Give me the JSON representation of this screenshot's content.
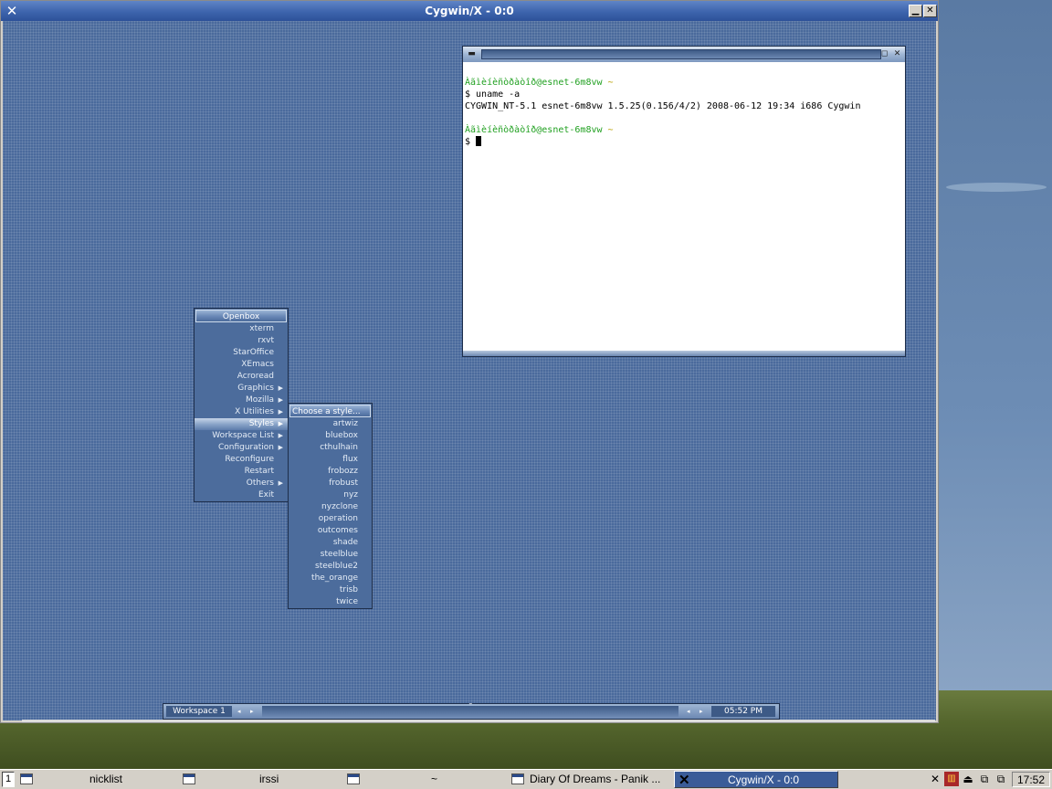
{
  "colors": {
    "titlebar": "#3d64ad",
    "desktop_grid": "#4a6a9c",
    "menu_bg": "#4c6c9c",
    "prompt_green": "#20a020",
    "prompt_tilde": "#b8a000",
    "taskbar": "#d4d0c8"
  },
  "xwindow": {
    "title": "Cygwin/X - 0:0",
    "minimize": "▁",
    "close": "✕",
    "icon": "x-logo-icon"
  },
  "terminal": {
    "title_mark": "˜",
    "lines": [
      {
        "prompt_user": "Àãìèíèñòðàòîð@esnet-6m8vw",
        "prompt_dir": "~"
      },
      {
        "text": "$ uname -a"
      },
      {
        "text": "CYGWIN_NT-5.1 esnet-6m8vw 1.5.25(0.156/4/2) 2008-06-12 19:34 i686 Cygwin"
      },
      {
        "text": ""
      },
      {
        "prompt_user": "Àãìèíèñòðàòîð@esnet-6m8vw",
        "prompt_dir": "~"
      },
      {
        "text": "$ "
      }
    ]
  },
  "openbox_menu": {
    "title": "Openbox",
    "items": [
      {
        "label": "xterm",
        "submenu": false
      },
      {
        "label": "rxvt",
        "submenu": false
      },
      {
        "label": "StarOffice",
        "submenu": false
      },
      {
        "label": "XEmacs",
        "submenu": false
      },
      {
        "label": "Acroread",
        "submenu": false
      },
      {
        "label": "Graphics",
        "submenu": true
      },
      {
        "label": "Mozilla",
        "submenu": true
      },
      {
        "label": "X Utilities",
        "submenu": true
      },
      {
        "label": "Styles",
        "submenu": true,
        "active": true
      },
      {
        "label": "Workspace List",
        "submenu": true
      },
      {
        "label": "Configuration",
        "submenu": true
      },
      {
        "label": "Reconfigure",
        "submenu": false
      },
      {
        "label": "Restart",
        "submenu": false
      },
      {
        "label": "Others",
        "submenu": true
      },
      {
        "label": "Exit",
        "submenu": false
      }
    ]
  },
  "styles_menu": {
    "title": "Choose a style...",
    "items": [
      "artwiz",
      "bluebox",
      "cthulhain",
      "flux",
      "frobozz",
      "frobust",
      "nyz",
      "nyzclone",
      "operation",
      "outcomes",
      "shade",
      "steelblue",
      "steelblue2",
      "the_orange",
      "trisb",
      "twice"
    ]
  },
  "openbox_toolbar": {
    "workspace": "Workspace 1",
    "prev": "◂",
    "next": "▸",
    "mid_mark": "˜",
    "clock": "05:52 PM"
  },
  "taskbar": {
    "desktop_number": "1",
    "tasks": [
      {
        "label": "nicklist"
      },
      {
        "label": "irssi"
      },
      {
        "label": "~"
      },
      {
        "label": "Diary Of Dreams - Panik ..."
      },
      {
        "label": "Cygwin/X - 0:0",
        "active": true
      }
    ],
    "tray_icons": [
      "x-server-icon",
      "winamp-icon",
      "eject-icon",
      "network-icon",
      "network-icon-2"
    ],
    "clock": "17:52"
  }
}
